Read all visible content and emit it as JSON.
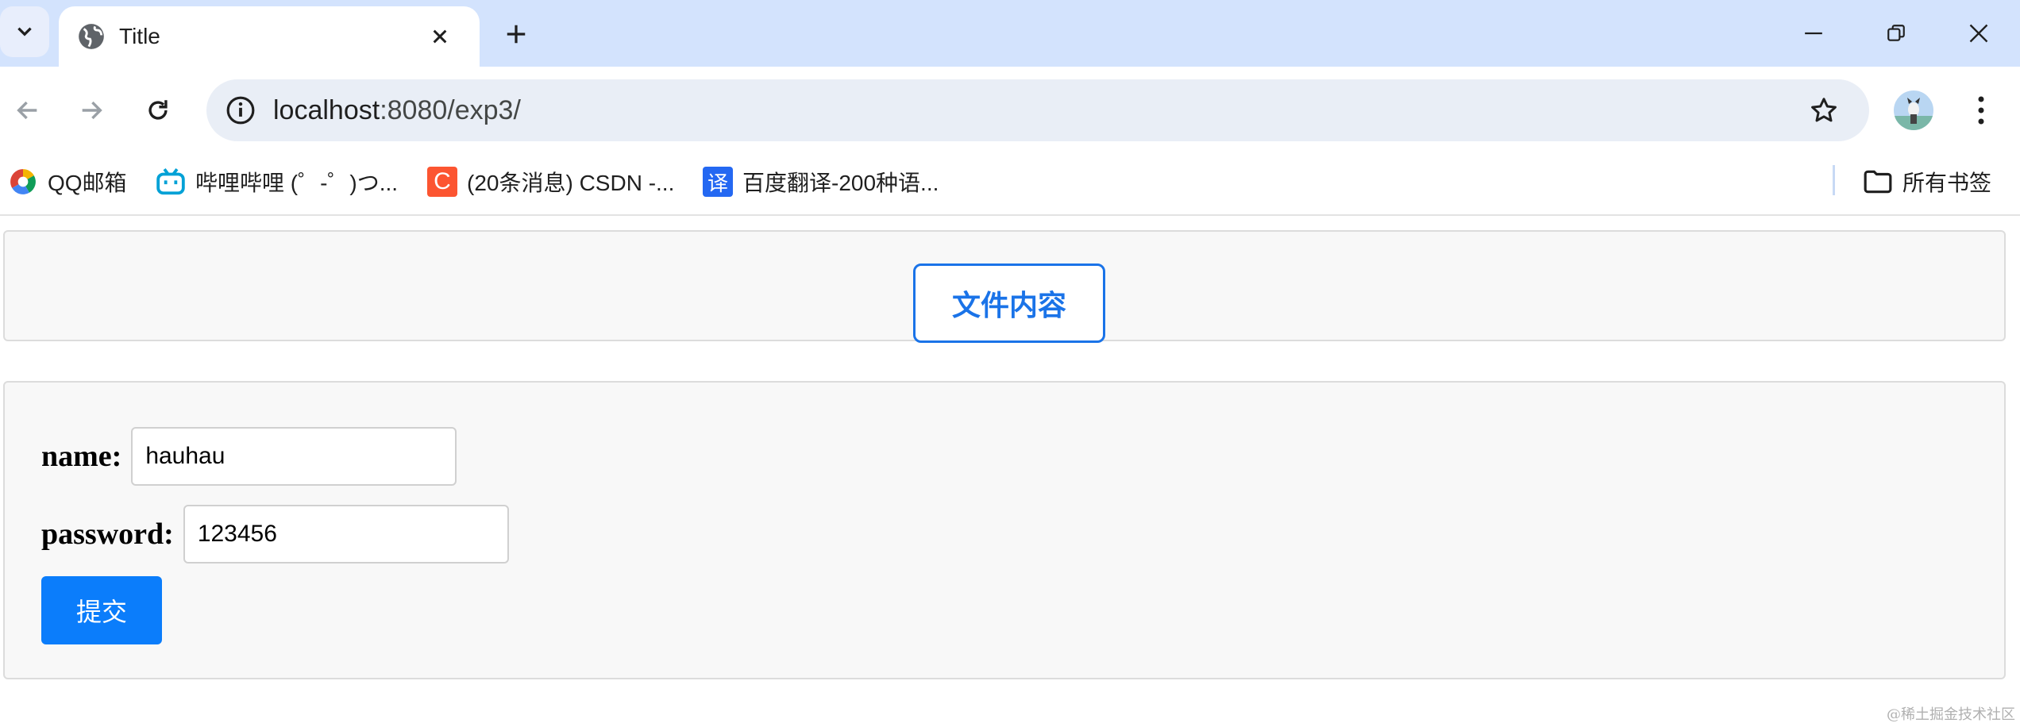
{
  "browser": {
    "tab": {
      "title": "Title"
    },
    "address": {
      "host": "localhost",
      "path": ":8080/exp3/"
    },
    "bookmarks": [
      {
        "label": "QQ邮箱",
        "icon": "qq-mail-icon"
      },
      {
        "label": "哔哩哔哩 (゜-゜)つ...",
        "icon": "bilibili-icon"
      },
      {
        "label": "(20条消息) CSDN -...",
        "icon": "csdn-icon",
        "icon_text": "C"
      },
      {
        "label": "百度翻译-200种语...",
        "icon": "baidu-translate-icon",
        "icon_text": "译"
      }
    ],
    "all_bookmarks_label": "所有书签"
  },
  "page": {
    "file_button_label": "文件内容",
    "form": {
      "name_label": "name:",
      "name_value": "hauhau",
      "password_label": "password:",
      "password_value": "123456",
      "submit_label": "提交"
    }
  },
  "watermark": "@稀土掘金技术社区",
  "colors": {
    "tabstrip": "#d3e3fd",
    "accent": "#1a73e8",
    "submit": "#0b7dfb"
  }
}
